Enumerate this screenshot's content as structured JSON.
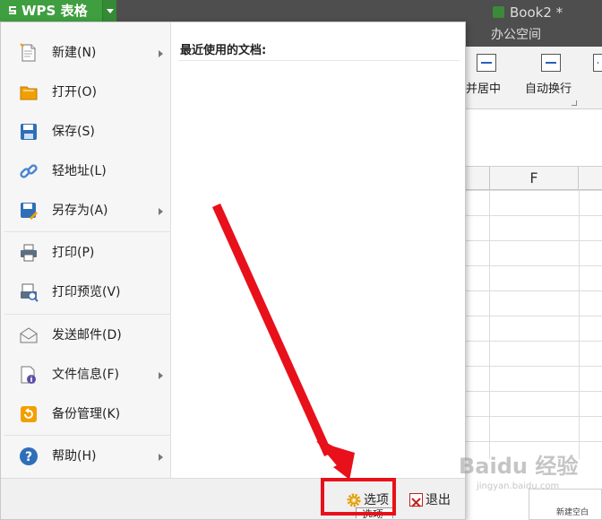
{
  "app": {
    "name": "WPS 表格",
    "document_tab": "Book2 *",
    "ribbon_tab": "办公空间"
  },
  "ribbon": {
    "merge_center_label": "并居中",
    "wrap_text_label": "自动换行"
  },
  "sheet": {
    "column_header": "F"
  },
  "menu": {
    "items": [
      {
        "label": "新建(N)",
        "icon": "new-file-icon",
        "submenu": true
      },
      {
        "label": "打开(O)",
        "icon": "open-folder-icon",
        "submenu": false
      },
      {
        "label": "保存(S)",
        "icon": "save-icon",
        "submenu": false
      },
      {
        "label": "轻地址(L)",
        "icon": "link-icon",
        "submenu": false
      },
      {
        "label": "另存为(A)",
        "icon": "save-as-icon",
        "submenu": true
      },
      {
        "label": "打印(P)",
        "icon": "print-icon",
        "submenu": false
      },
      {
        "label": "打印预览(V)",
        "icon": "print-preview-icon",
        "submenu": false
      },
      {
        "label": "发送邮件(D)",
        "icon": "mail-icon",
        "submenu": false
      },
      {
        "label": "文件信息(F)",
        "icon": "file-info-icon",
        "submenu": true
      },
      {
        "label": "备份管理(K)",
        "icon": "backup-icon",
        "submenu": false
      },
      {
        "label": "帮助(H)",
        "icon": "help-icon",
        "submenu": true
      }
    ],
    "recent_title": "最近使用的文档:",
    "options_label": "选项",
    "exit_label": "退出",
    "tooltip": "选项"
  },
  "thumbnail_label": "新建空白",
  "watermark": {
    "text": "Baidu 经验",
    "sub": "jingyan.baidu.com"
  },
  "colors": {
    "app_green": "#3f9e3f",
    "title_bar": "#4e4e4e",
    "highlight_red": "#e8101a"
  }
}
